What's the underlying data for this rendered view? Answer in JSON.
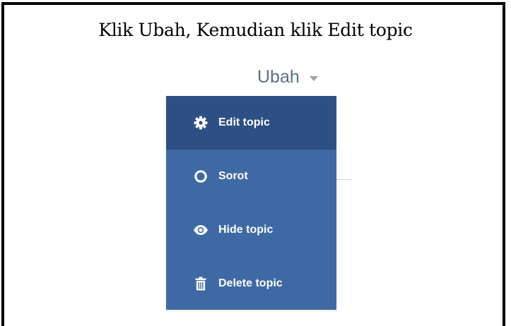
{
  "caption": "Klik Ubah, Kemudian klik Edit topic",
  "dropdown": {
    "label": "Ubah",
    "caret_icon": "caret-down-icon"
  },
  "menu": {
    "items": [
      {
        "label": "Edit topic",
        "icon": "gear-icon",
        "active": true
      },
      {
        "label": "Sorot",
        "icon": "circle-outline-icon",
        "active": false
      },
      {
        "label": "Hide topic",
        "icon": "eye-icon",
        "active": false
      },
      {
        "label": "Delete topic",
        "icon": "trash-icon",
        "active": false
      }
    ]
  },
  "colors": {
    "menu_bg": "#3f69a4",
    "menu_active_bg": "#2d4f83",
    "dropdown_text": "#5b6f8a",
    "border": "#000000"
  }
}
